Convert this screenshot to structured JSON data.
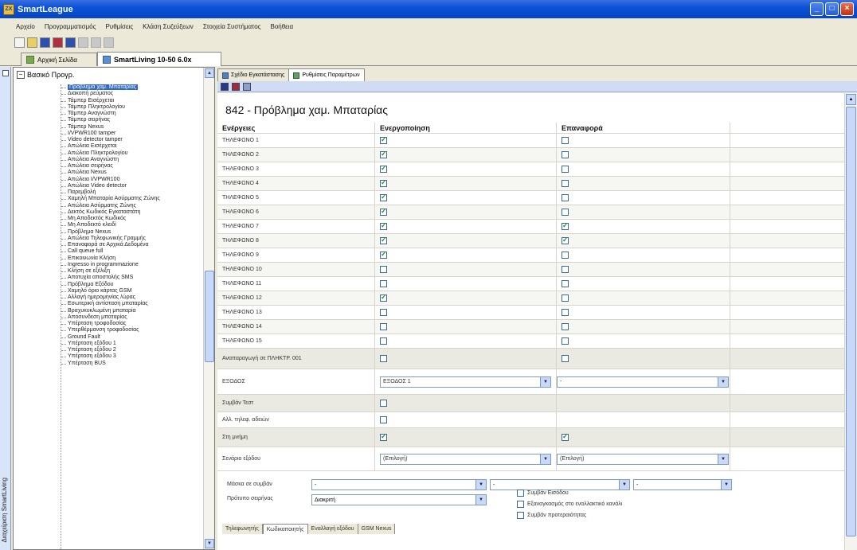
{
  "window": {
    "title": "SmartLeague"
  },
  "menu": [
    "Αρχείο",
    "Προγραμματισμός",
    "Ρυθμίσεις",
    "Κλάση Συζεύξεων",
    "Στοιχεία Συστήματος",
    "Βοήθεια"
  ],
  "doc_tabs": [
    {
      "label": "Αρχική Σελίδα",
      "active": false
    },
    {
      "label": "SmartLiving 10-50 6.0x",
      "active": true
    }
  ],
  "vertical_strip_label": "Διαχείριση SmartLiving",
  "tree": {
    "root": "Βασικό Προγρ.",
    "items": [
      "Πρόβλημα χαμ. Μπαταρίας",
      "Διακοπή ρεύματος",
      "Τάμπερ Εισέρχεται",
      "Τάμπερ Πληκτρολογίου",
      "Τάμπερ Αναγνώστη",
      "Τάμπερ σειρήνας",
      "Τάμπερ Nexus",
      "I/VPWR100 tamper",
      "Video detector tamper",
      "Απώλεια Εισέρχεται",
      "Απώλεια Πληκτρολογίου",
      "Απώλεια Αναγνώστη",
      "Απώλεια σειρήνας",
      "Απώλεια Nexus",
      "Απώλεια I/VPWR100",
      "Απώλεια Video detector",
      "Παρεμβολή",
      "Χαμηλή Μπαταρία Ασύρματης Ζώνης",
      "Απώλεια Ασύρματης Ζώνης",
      "Δεκτός Κωδικός Εγκαταστάτη",
      "Μη Αποδεκτός Κωδικός",
      "Μη Αποδεκτό κλειδί",
      "Πρόβλημα Nexus",
      "Απώλεια Τηλεφωνικής Γραμμής",
      "Επαναφορά σε Αρχικά Δεδομένα",
      "Call queue full",
      "Επικοινωνία Κλήση",
      "Ingresso in programmazione",
      "Κλήση σε εξέλιξη",
      "Αποτυχία αποστολής SMS",
      "Πρόβλημα Εξόδου",
      "Χαμηλό όριο κάρτας GSM",
      "Αλλαγή ημερομηνίας /ώρας",
      "Εσωτερική αντίσταση μπαταρίας",
      "Βραχυκυκλωμένη μπαταρία",
      "Αποσυνδεση μπαταρίας",
      "Υπέρταση τροφοδοσίας",
      "Υπερθέρμανση τροφοδοσίας",
      "Ground Fault",
      "Υπέρταση εξόδου 1",
      "Υπέρταση εξόδου 2",
      "Υπέρταση εξόδου 3",
      "Υπέρταση BUS"
    ]
  },
  "sub_tabs": [
    {
      "label": "Σχέδιο Εγκατάστασης",
      "active": false
    },
    {
      "label": "Ρυθμίσεις Παραμέτρων",
      "active": true
    }
  ],
  "event_title": "842 - Πρόβλημα χαμ. Μπαταρίας",
  "grid": {
    "headers": [
      "Ενέργειες",
      "Ενεργοποίηση",
      "Επαναφορά"
    ],
    "phones": [
      {
        "label": "ΤΗΛΕΦΩΝΟ 1",
        "activate": true,
        "restore": false
      },
      {
        "label": "ΤΗΛΕΦΩΝΟ 2",
        "activate": true,
        "restore": false
      },
      {
        "label": "ΤΗΛΕΦΩΝΟ 3",
        "activate": true,
        "restore": false
      },
      {
        "label": "ΤΗΛΕΦΩΝΟ 4",
        "activate": true,
        "restore": false
      },
      {
        "label": "ΤΗΛΕΦΩΝΟ 5",
        "activate": true,
        "restore": false
      },
      {
        "label": "ΤΗΛΕΦΩΝΟ 6",
        "activate": true,
        "restore": false
      },
      {
        "label": "ΤΗΛΕΦΩΝΟ 7",
        "activate": true,
        "restore": true
      },
      {
        "label": "ΤΗΛΕΦΩΝΟ 8",
        "activate": true,
        "restore": true
      },
      {
        "label": "ΤΗΛΕΦΩΝΟ 9",
        "activate": true,
        "restore": false
      },
      {
        "label": "ΤΗΛΕΦΩΝΟ 10",
        "activate": false,
        "restore": false
      },
      {
        "label": "ΤΗΛΕΦΩΝΟ 11",
        "activate": false,
        "restore": false
      },
      {
        "label": "ΤΗΛΕΦΩΝΟ 12",
        "activate": true,
        "restore": false
      },
      {
        "label": "ΤΗΛΕΦΩΝΟ 13",
        "activate": false,
        "restore": false
      },
      {
        "label": "ΤΗΛΕΦΩΝΟ 14",
        "activate": false,
        "restore": false
      },
      {
        "label": "ΤΗΛΕΦΩΝΟ 15",
        "activate": false,
        "restore": false
      }
    ],
    "playback_label": "Αναπαραγωγή σε ΠΛΗΚΤΡ. 001",
    "output_label": "ΕΞΟΔΟΣ",
    "output_activate_value": "ΕΞΟΔΟΣ 1",
    "output_restore_value": "-",
    "test_label": "Συμβάν Τεστ",
    "change_label": "Αλλ. τηλεφ. αδειών",
    "memory_label": "Στη μνήμη",
    "output_type_label": "Σενάριο εξόδου",
    "output_type_activate": "(Επιλογή)",
    "output_type_restore": "(Επιλογή)"
  },
  "bottom_form": {
    "mask_label": "Μάσκα σε συμβάν",
    "mask_1": "-",
    "mask_2": "-",
    "mask_3": "-",
    "siren_label": "Πρότυπο σειρήνας",
    "siren_value": "Διακριτή",
    "checks": [
      {
        "label": "Συμβάν Εισόδου",
        "checked": false
      },
      {
        "label": "Εξαναγκασμός στο εναλλακτικό κανάλι",
        "checked": false
      },
      {
        "label": "Συμβάν προτεραιότητας",
        "checked": false
      }
    ]
  },
  "bottom_tabs": [
    {
      "label": "Τηλεφωνητής",
      "active": false
    },
    {
      "label": "Κωδικοποιητής",
      "active": true
    },
    {
      "label": "Εναλλαγή εξόδου",
      "active": false
    },
    {
      "label": "GSM Nexus",
      "active": false
    }
  ]
}
